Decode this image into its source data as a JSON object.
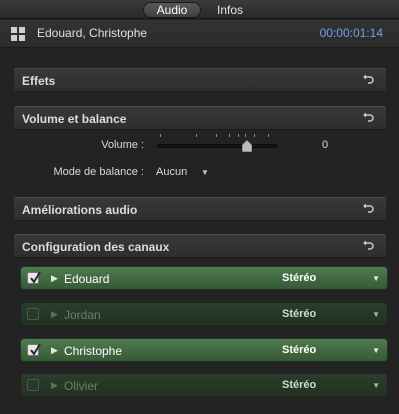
{
  "tabs": {
    "audio": "Audio",
    "infos": "Infos"
  },
  "header": {
    "title": "Edouard, Christophe",
    "timecode": "00:00:01:14"
  },
  "sections": {
    "effets": "Effets",
    "volume_balance": "Volume et balance",
    "ameliorations": "Améliorations audio",
    "configuration": "Configuration des canaux"
  },
  "volume": {
    "label": "Volume :",
    "value": "0"
  },
  "balance": {
    "label": "Mode de balance :",
    "value": "Aucun"
  },
  "channels": [
    {
      "name": "Edouard",
      "mode": "Stéréo",
      "enabled": true
    },
    {
      "name": "Jordan",
      "mode": "Stéréo",
      "enabled": false
    },
    {
      "name": "Christophe",
      "mode": "Stéréo",
      "enabled": true
    },
    {
      "name": "Olivier",
      "mode": "Stéréo",
      "enabled": false
    }
  ],
  "icons": {
    "grid": "grid-icon",
    "reset": "reset-arrow-icon",
    "check": "checkmark-icon",
    "disclosure": "disclosure-triangle-icon",
    "dropdown": "chevron-down-icon"
  },
  "colors": {
    "timecode": "#6fa0e8",
    "channel_active": "#4f7a4f",
    "channel_inactive": "#2b3d2b"
  }
}
